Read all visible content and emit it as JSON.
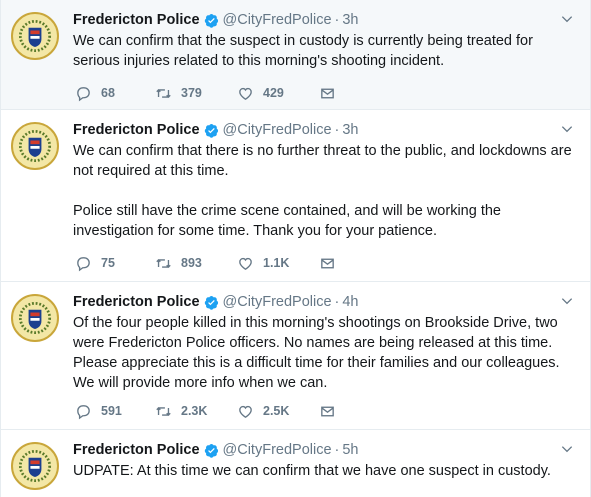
{
  "tweets": [
    {
      "name": "Fredericton Police",
      "handle": "@CityFredPolice",
      "separator": "·",
      "time": "3h",
      "text": [
        "We can confirm that the suspect in custody is currently being treated for serious injuries related to this morning's shooting incident."
      ],
      "replies": "68",
      "retweets": "379",
      "likes": "429"
    },
    {
      "name": "Fredericton Police",
      "handle": "@CityFredPolice",
      "separator": "·",
      "time": "3h",
      "text": [
        "We can confirm that there is no further threat to the public, and lockdowns are not required at this time.",
        "Police still have the crime scene contained, and will be working the investigation for some time. Thank you for your patience."
      ],
      "replies": "75",
      "retweets": "893",
      "likes": "1.1K"
    },
    {
      "name": "Fredericton Police",
      "handle": "@CityFredPolice",
      "separator": "·",
      "time": "4h",
      "text": [
        "Of the four people killed in this morning's shootings on Brookside Drive, two were Fredericton Police officers.  No names are being released at this time. Please appreciate this is a difficult time for their families and our colleagues.  We will provide more info when we can."
      ],
      "replies": "591",
      "retweets": "2.3K",
      "likes": "2.5K"
    },
    {
      "name": "Fredericton Police",
      "handle": "@CityFredPolice",
      "separator": "·",
      "time": "5h",
      "text": [
        "UDPATE: At this time we can confirm that we have one suspect in custody."
      ]
    }
  ],
  "colors": {
    "verified": "#1da1f2",
    "secondary_text": "#657786",
    "highlight_background": "#f5f8fa",
    "divider": "#e6ecf0"
  },
  "icons": {
    "reply": "reply-icon",
    "retweet": "retweet-icon",
    "like": "heart-icon",
    "dm": "envelope-icon",
    "verified": "verified-badge-icon",
    "menu": "chevron-down-icon"
  }
}
